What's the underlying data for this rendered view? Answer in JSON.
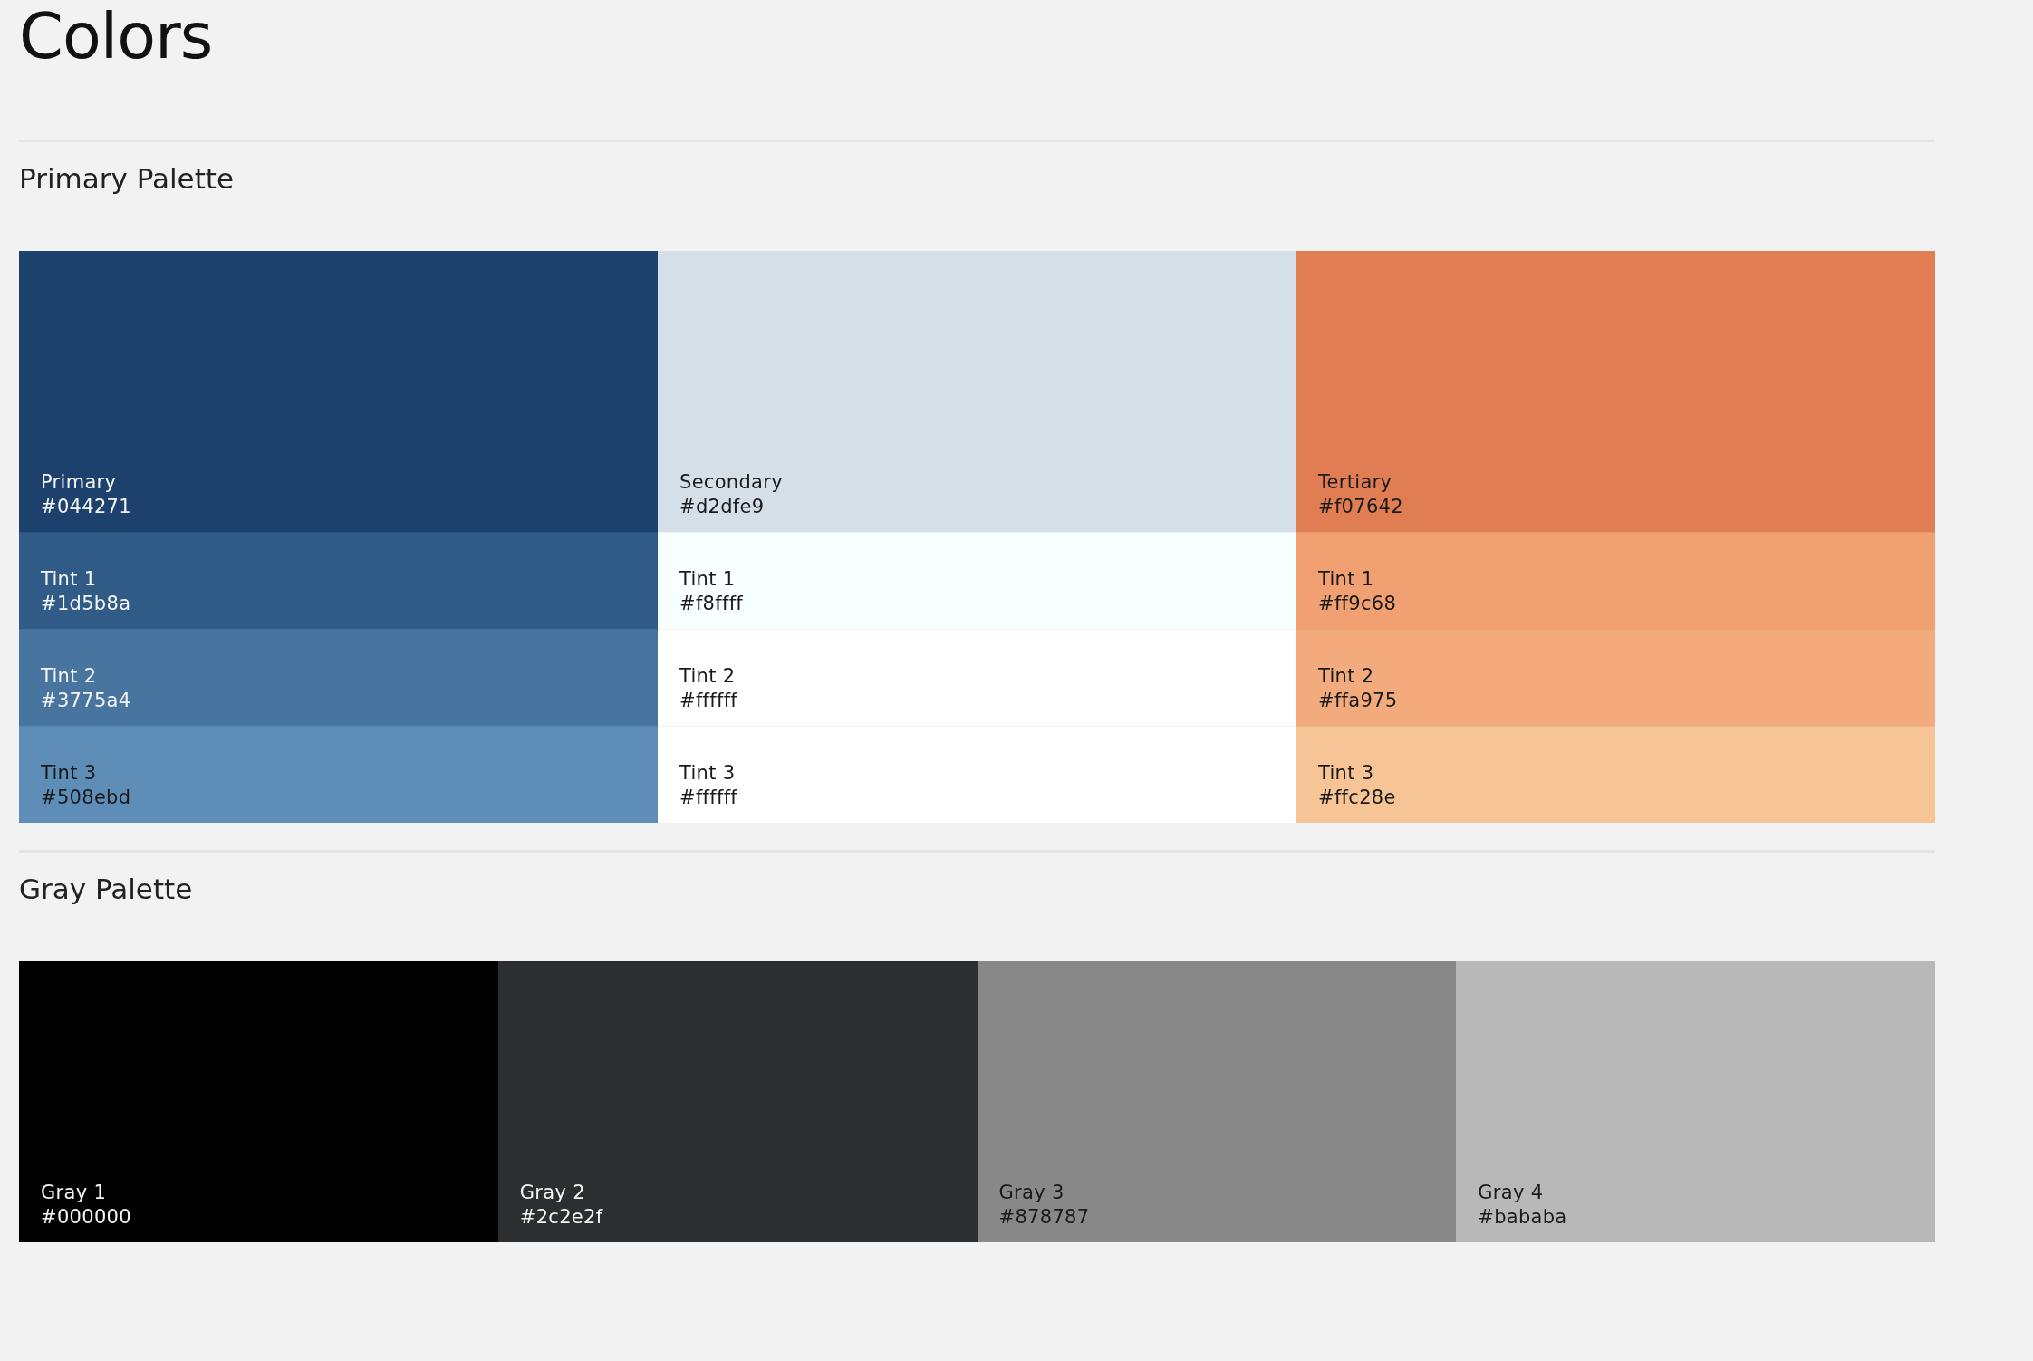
{
  "title": "Colors",
  "sections": [
    {
      "heading": "Primary Palette",
      "kind": "columns",
      "columns": [
        {
          "main": {
            "name": "Primary",
            "hex": "#044271",
            "color": "#1c416d"
          },
          "tints": [
            {
              "name": "Tint 1",
              "hex": "#1d5b8a",
              "color": "#2f5b86"
            },
            {
              "name": "Tint 2",
              "hex": "#3775a4",
              "color": "#4874a0"
            },
            {
              "name": "Tint 3",
              "hex": "#508ebd",
              "color": "#5e8db8"
            }
          ]
        },
        {
          "main": {
            "name": "Secondary",
            "hex": "#d2dfe9",
            "color": "#d5dfe8"
          },
          "tints": [
            {
              "name": "Tint 1",
              "hex": "#f8ffff",
              "color": "#f8ffff"
            },
            {
              "name": "Tint 2",
              "hex": "#ffffff",
              "color": "#ffffff"
            },
            {
              "name": "Tint 3",
              "hex": "#ffffff",
              "color": "#ffffff"
            }
          ]
        },
        {
          "main": {
            "name": "Tertiary",
            "hex": "#f07642",
            "color": "#e17d52"
          },
          "tints": [
            {
              "name": "Tint 1",
              "hex": "#ff9c68",
              "color": "#f1a072"
            },
            {
              "name": "Tint 2",
              "hex": "#ffa975",
              "color": "#f3ab7d"
            },
            {
              "name": "Tint 3",
              "hex": "#ffc28e",
              "color": "#f7c496"
            }
          ]
        }
      ]
    },
    {
      "heading": "Gray Palette",
      "kind": "row",
      "swatches": [
        {
          "name": "Gray 1",
          "hex": "#000000",
          "color": "#000000"
        },
        {
          "name": "Gray 2",
          "hex": "#2c2e2f",
          "color": "#2d2e30"
        },
        {
          "name": "Gray 3",
          "hex": "#878787",
          "color": "#888888"
        },
        {
          "name": "Gray 4",
          "hex": "#bababa",
          "color": "#b8b8b8"
        }
      ]
    }
  ]
}
